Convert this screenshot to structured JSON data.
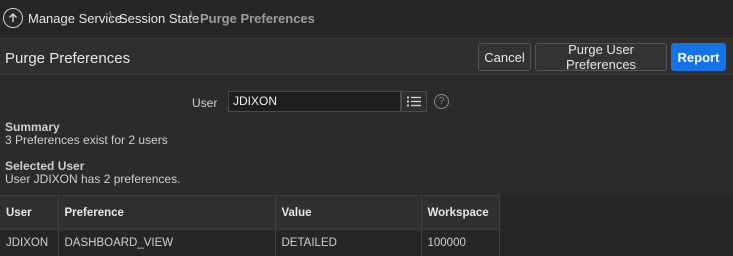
{
  "breadcrumb": {
    "items": [
      {
        "label": "Manage Service"
      },
      {
        "label": "Session State"
      },
      {
        "label": "Purge Preferences"
      }
    ],
    "separator": "\\"
  },
  "region": {
    "title": "Purge Preferences",
    "buttons": {
      "cancel": "Cancel",
      "purge": "Purge User Preferences",
      "report": "Report"
    }
  },
  "form": {
    "user_label": "User",
    "user_value": "JDIXON",
    "help": "?"
  },
  "summary": {
    "heading": "Summary",
    "text": "3 Preferences exist for 2 users"
  },
  "selected_user": {
    "heading": "Selected User",
    "text": "User JDIXON has 2 preferences."
  },
  "table": {
    "columns": [
      "User",
      "Preference",
      "Value",
      "Workspace"
    ],
    "rows": [
      [
        "JDIXON",
        "DASHBOARD_VIEW",
        "DETAILED",
        "100000"
      ]
    ]
  },
  "colors": {
    "background": "#262626",
    "accent": "#1473e6"
  }
}
